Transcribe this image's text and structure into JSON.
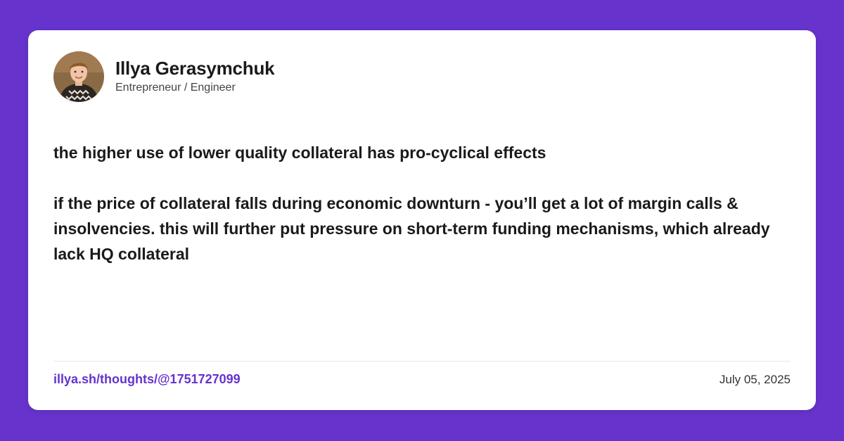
{
  "author": {
    "name": "Illya Gerasymchuk",
    "role": "Entrepreneur / Engineer"
  },
  "post": {
    "paragraphs": [
      "the higher use of lower quality collateral has pro-cyclical effects",
      "if the price of collateral falls during economic downturn - you’ll get a lot of margin calls & insolvencies. this will further put pressure on short-term funding mechanisms, which already lack HQ collateral"
    ]
  },
  "footer": {
    "permalink": "illya.sh/thoughts/@1751727099",
    "date": "July 05, 2025"
  },
  "colors": {
    "background": "#6633cc",
    "card": "#ffffff",
    "accent": "#6633cc",
    "text": "#1a1a1a"
  }
}
